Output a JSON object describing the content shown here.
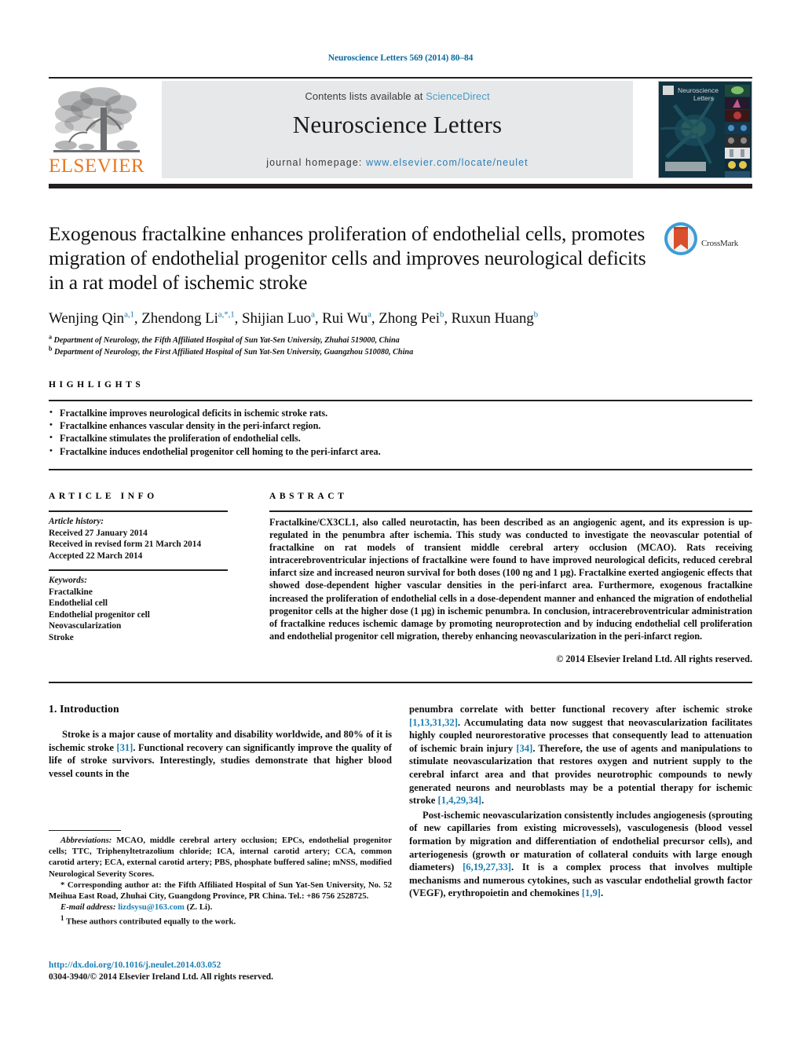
{
  "running_head": "Neuroscience Letters 569 (2014) 80–84",
  "masthead": {
    "contents_prefix": "Contents lists available at ",
    "sciencedirect": "ScienceDirect",
    "journal_title": "Neuroscience Letters",
    "homepage_prefix": "journal homepage: ",
    "homepage_url": "www.elsevier.com/locate/neulet",
    "publisher": "ELSEVIER",
    "cover_title_line1": "Neuroscience",
    "cover_title_line2": "Letters"
  },
  "crossmark": {
    "label": "CrossMark"
  },
  "article": {
    "title": "Exogenous fractalkine enhances proliferation of endothelial cells, promotes migration of endothelial progenitor cells and improves neurological deficits in a rat model of ischemic stroke",
    "authors_html": "Wenjing Qin<sup>a,1</sup>, Zhendong Li<sup>a,*,1</sup>, Shijian Luo<sup>a</sup>, Rui Wu<sup>a</sup>, Zhong Pei<sup>b</sup>, Ruxun Huang<sup>b</sup>",
    "affiliation_a": "Department of Neurology, the Fifth Affiliated Hospital of Sun Yat-Sen University, Zhuhai 519000, China",
    "affiliation_b": "Department of Neurology, the First Affiliated Hospital of Sun Yat-Sen University, Guangzhou 510080, China"
  },
  "highlights": {
    "heading": "HIGHLIGHTS",
    "items": [
      "Fractalkine improves neurological deficits in ischemic stroke rats.",
      "Fractalkine enhances vascular density in the peri-infarct region.",
      "Fractalkine stimulates the proliferation of endothelial cells.",
      "Fractalkine induces endothelial progenitor cell homing to the peri-infarct area."
    ]
  },
  "article_info": {
    "heading": "ARTICLE INFO",
    "history_label": "Article history:",
    "history": [
      "Received 27 January 2014",
      "Received in revised form 21 March 2014",
      "Accepted 22 March 2014"
    ],
    "keywords_label": "Keywords:",
    "keywords": [
      "Fractalkine",
      "Endothelial cell",
      "Endothelial progenitor cell",
      "Neovascularization",
      "Stroke"
    ]
  },
  "abstract": {
    "heading": "ABSTRACT",
    "text": "Fractalkine/CX3CL1, also called neurotactin, has been described as an angiogenic agent, and its expression is up-regulated in the penumbra after ischemia. This study was conducted to investigate the neovascular potential of fractalkine on rat models of transient middle cerebral artery occlusion (MCAO). Rats receiving intracerebroventricular injections of fractalkine were found to have improved neurological deficits, reduced cerebral infarct size and increased neuron survival for both doses (100 ng and 1 µg). Fractalkine exerted angiogenic effects that showed dose-dependent higher vascular densities in the peri-infarct area. Furthermore, exogenous fractalkine increased the proliferation of endothelial cells in a dose-dependent manner and enhanced the migration of endothelial progenitor cells at the higher dose (1 µg) in ischemic penumbra. In conclusion, intracerebroventricular administration of fractalkine reduces ischemic damage by promoting neuroprotection and by inducing endothelial cell proliferation and endothelial progenitor cell migration, thereby enhancing neovascularization in the peri-infarct region.",
    "copyright": "© 2014 Elsevier Ireland Ltd. All rights reserved."
  },
  "body": {
    "section_heading": "1. Introduction",
    "left_paragraph_1_a": "Stroke is a major cause of mortality and disability worldwide, and 80% of it is ischemic stroke ",
    "left_paragraph_1_ref1": "[31]",
    "left_paragraph_1_b": ". Functional recovery can significantly improve the quality of life of stroke survivors. Interestingly, studies demonstrate that higher blood vessel counts in the",
    "right_paragraph_1_a": "penumbra correlate with better functional recovery after ischemic stroke ",
    "right_paragraph_1_ref1": "[1,13,31,32]",
    "right_paragraph_1_b": ". Accumulating data now suggest that neovascularization facilitates highly coupled neurorestorative processes that consequently lead to attenuation of ischemic brain injury ",
    "right_paragraph_1_ref2": "[34]",
    "right_paragraph_1_c": ". Therefore, the use of agents and manipulations to stimulate neovascularization that restores oxygen and nutrient supply to the cerebral infarct area and that provides neurotrophic compounds to newly generated neurons and neuroblasts may be a potential therapy for ischemic stroke ",
    "right_paragraph_1_ref3": "[1,4,29,34]",
    "right_paragraph_1_d": ".",
    "right_paragraph_2_a": "Post-ischemic neovascularization consistently includes angiogenesis (sprouting of new capillaries from existing microvessels), vasculogenesis (blood vessel formation by migration and differentiation of endothelial precursor cells), and arteriogenesis (growth or maturation of collateral conduits with large enough diameters) ",
    "right_paragraph_2_ref1": "[6,19,27,33]",
    "right_paragraph_2_b": ". It is a complex process that involves multiple mechanisms and numerous cytokines, such as vascular endothelial growth factor (VEGF), erythropoietin and chemokines ",
    "right_paragraph_2_ref2": "[1,9]",
    "right_paragraph_2_c": "."
  },
  "footnotes": {
    "abbreviations_label": "Abbreviations:",
    "abbreviations_text": " MCAO, middle cerebral artery occlusion; EPCs, endothelial progenitor cells; TTC, Triphenyltetrazolium chloride; ICA, internal carotid artery; CCA, common carotid artery; ECA, external carotid artery; PBS, phosphate buffered saline; mNSS, modified Neurological Severity Scores.",
    "corresponding_marker": "*",
    "corresponding_text": " Corresponding author at: the Fifth Affiliated Hospital of Sun Yat-Sen University, No. 52 Meihua East Road, Zhuhai City, Guangdong Province, PR China. Tel.: +86 756 2528725.",
    "email_label": "E-mail address:",
    "email_address": "lizdsysu@163.com",
    "email_suffix": " (Z. Li).",
    "equal_marker": "1",
    "equal_text": " These authors contributed equally to the work."
  },
  "footer": {
    "doi_url": "http://dx.doi.org/10.1016/j.neulet.2014.03.052",
    "issn_copyright": "0304-3940/© 2014 Elsevier Ireland Ltd. All rights reserved."
  },
  "colors": {
    "link": "#1a7fb5",
    "running_head": "#0b6b9e",
    "elsevier_orange": "#e87722",
    "masthead_bg": "#e7e8ea",
    "rule": "#231f20",
    "sciencedirect": "#4a9bc4"
  }
}
